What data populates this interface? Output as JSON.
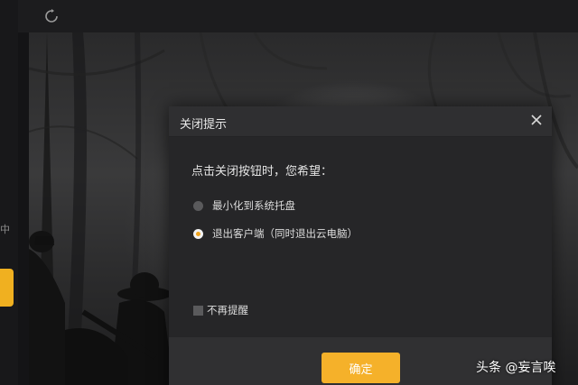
{
  "dialog": {
    "title": "关闭提示",
    "question": "点击关闭按钮时，您希望：",
    "options": [
      {
        "label": "最小化到系统托盘",
        "selected": false
      },
      {
        "label": "退出客户端（同时退出云电脑）",
        "selected": true
      }
    ],
    "dont_remind_label": "不再提醒",
    "dont_remind_checked": false,
    "confirm_label": "确定",
    "close_icon": "close-icon"
  },
  "toolbar": {
    "refresh_icon": "refresh-icon"
  },
  "side": {
    "partial_char": "中"
  },
  "watermark": "头条 @妄言唉",
  "colors": {
    "accent": "#f5b12a",
    "dialog_bg": "#262628",
    "header_bg": "#2f2f31"
  }
}
